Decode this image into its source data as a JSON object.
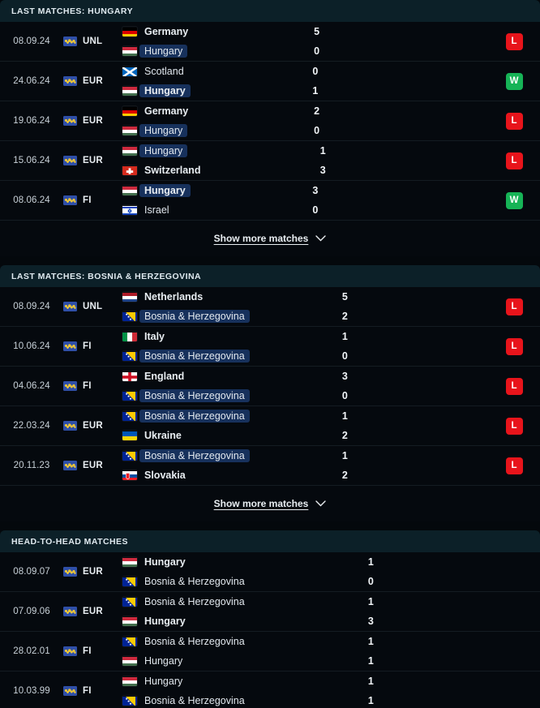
{
  "colors": {
    "background": "#04080c",
    "row_background": "#05090e",
    "section_header_background": "#0c2028",
    "highlight_background": "#17315c",
    "win_badge": "#16b356",
    "loss_badge": "#e8141b",
    "draw_badge": "#8b8f93",
    "text_primary": "#e9eef2",
    "text_date": "#c9d2d9",
    "divider": "#141c22"
  },
  "show_more_label": "Show more matches",
  "chevron_icon": "chevron-down-icon",
  "competition_icon": "world-map-icon",
  "sections": [
    {
      "id": "last-matches-hungary",
      "title": "LAST MATCHES: HUNGARY",
      "has_result_column": true,
      "has_show_more": true,
      "matches": [
        {
          "date": "08.09.24",
          "competition": "UNL",
          "home": {
            "name": "Germany",
            "flag": "germany",
            "winner": true,
            "highlight": false
          },
          "away": {
            "name": "Hungary",
            "flag": "hungary",
            "winner": false,
            "highlight": true
          },
          "home_score": "5",
          "away_score": "0",
          "result": "L"
        },
        {
          "date": "24.06.24",
          "competition": "EUR",
          "home": {
            "name": "Scotland",
            "flag": "scotland",
            "winner": false,
            "highlight": false
          },
          "away": {
            "name": "Hungary",
            "flag": "hungary",
            "winner": true,
            "highlight": true
          },
          "home_score": "0",
          "away_score": "1",
          "result": "W"
        },
        {
          "date": "19.06.24",
          "competition": "EUR",
          "home": {
            "name": "Germany",
            "flag": "germany",
            "winner": true,
            "highlight": false
          },
          "away": {
            "name": "Hungary",
            "flag": "hungary",
            "winner": false,
            "highlight": true
          },
          "home_score": "2",
          "away_score": "0",
          "result": "L"
        },
        {
          "date": "15.06.24",
          "competition": "EUR",
          "home": {
            "name": "Hungary",
            "flag": "hungary",
            "winner": false,
            "highlight": true
          },
          "away": {
            "name": "Switzerland",
            "flag": "switzerland",
            "winner": true,
            "highlight": false
          },
          "home_score": "1",
          "away_score": "3",
          "result": "L"
        },
        {
          "date": "08.06.24",
          "competition": "FI",
          "home": {
            "name": "Hungary",
            "flag": "hungary",
            "winner": true,
            "highlight": true
          },
          "away": {
            "name": "Israel",
            "flag": "israel",
            "winner": false,
            "highlight": false
          },
          "home_score": "3",
          "away_score": "0",
          "result": "W"
        }
      ]
    },
    {
      "id": "last-matches-bosnia",
      "title": "LAST MATCHES: BOSNIA & HERZEGOVINA",
      "has_result_column": true,
      "has_show_more": true,
      "matches": [
        {
          "date": "08.09.24",
          "competition": "UNL",
          "home": {
            "name": "Netherlands",
            "flag": "netherlands",
            "winner": true,
            "highlight": false
          },
          "away": {
            "name": "Bosnia & Herzegovina",
            "flag": "bosnia",
            "winner": false,
            "highlight": true
          },
          "home_score": "5",
          "away_score": "2",
          "result": "L"
        },
        {
          "date": "10.06.24",
          "competition": "FI",
          "home": {
            "name": "Italy",
            "flag": "italy",
            "winner": true,
            "highlight": false
          },
          "away": {
            "name": "Bosnia & Herzegovina",
            "flag": "bosnia",
            "winner": false,
            "highlight": true
          },
          "home_score": "1",
          "away_score": "0",
          "result": "L"
        },
        {
          "date": "04.06.24",
          "competition": "FI",
          "home": {
            "name": "England",
            "flag": "england",
            "winner": true,
            "highlight": false
          },
          "away": {
            "name": "Bosnia & Herzegovina",
            "flag": "bosnia",
            "winner": false,
            "highlight": true
          },
          "home_score": "3",
          "away_score": "0",
          "result": "L"
        },
        {
          "date": "22.03.24",
          "competition": "EUR",
          "home": {
            "name": "Bosnia & Herzegovina",
            "flag": "bosnia",
            "winner": false,
            "highlight": true
          },
          "away": {
            "name": "Ukraine",
            "flag": "ukraine",
            "winner": true,
            "highlight": false
          },
          "home_score": "1",
          "away_score": "2",
          "result": "L"
        },
        {
          "date": "20.11.23",
          "competition": "EUR",
          "home": {
            "name": "Bosnia & Herzegovina",
            "flag": "bosnia",
            "winner": false,
            "highlight": true
          },
          "away": {
            "name": "Slovakia",
            "flag": "slovakia",
            "winner": true,
            "highlight": false
          },
          "home_score": "1",
          "away_score": "2",
          "result": "L"
        }
      ]
    },
    {
      "id": "head-to-head-matches",
      "title": "HEAD-TO-HEAD MATCHES",
      "has_result_column": false,
      "has_show_more": false,
      "matches": [
        {
          "date": "08.09.07",
          "competition": "EUR",
          "home": {
            "name": "Hungary",
            "flag": "hungary",
            "winner": true,
            "highlight": false
          },
          "away": {
            "name": "Bosnia & Herzegovina",
            "flag": "bosnia",
            "winner": false,
            "highlight": false
          },
          "home_score": "1",
          "away_score": "0",
          "result": ""
        },
        {
          "date": "07.09.06",
          "competition": "EUR",
          "home": {
            "name": "Bosnia & Herzegovina",
            "flag": "bosnia",
            "winner": false,
            "highlight": false
          },
          "away": {
            "name": "Hungary",
            "flag": "hungary",
            "winner": true,
            "highlight": false
          },
          "home_score": "1",
          "away_score": "3",
          "result": ""
        },
        {
          "date": "28.02.01",
          "competition": "FI",
          "home": {
            "name": "Bosnia & Herzegovina",
            "flag": "bosnia",
            "winner": false,
            "highlight": false
          },
          "away": {
            "name": "Hungary",
            "flag": "hungary",
            "winner": false,
            "highlight": false
          },
          "home_score": "1",
          "away_score": "1",
          "result": ""
        },
        {
          "date": "10.03.99",
          "competition": "FI",
          "home": {
            "name": "Hungary",
            "flag": "hungary",
            "winner": false,
            "highlight": false
          },
          "away": {
            "name": "Bosnia & Herzegovina",
            "flag": "bosnia",
            "winner": false,
            "highlight": false
          },
          "home_score": "1",
          "away_score": "1",
          "result": ""
        }
      ]
    }
  ]
}
